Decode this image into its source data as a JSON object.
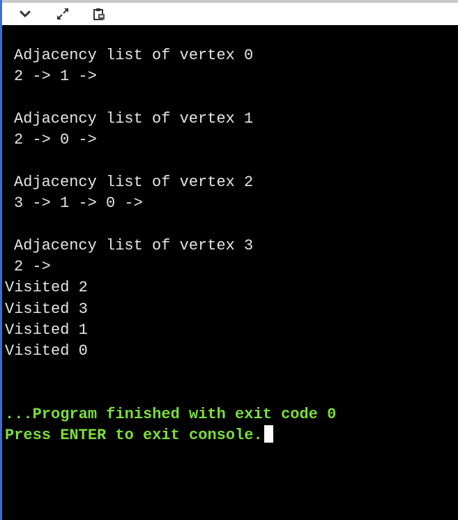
{
  "toolbar": {
    "collapse_icon": "chevron-down-icon",
    "expand_icon": "expand-arrows-icon",
    "save_icon": "clipboard-save-icon"
  },
  "console": {
    "output": [
      {
        "text": "Adjacency list of vertex 0",
        "indent": true
      },
      {
        "text": "2 -> 1 ->",
        "indent": true
      },
      {
        "text": "",
        "indent": true
      },
      {
        "text": "Adjacency list of vertex 1",
        "indent": true
      },
      {
        "text": "2 -> 0 ->",
        "indent": true
      },
      {
        "text": "",
        "indent": true
      },
      {
        "text": "Adjacency list of vertex 2",
        "indent": true
      },
      {
        "text": "3 -> 1 -> 0 ->",
        "indent": true
      },
      {
        "text": "",
        "indent": true
      },
      {
        "text": "Adjacency list of vertex 3",
        "indent": true
      },
      {
        "text": "2 ->",
        "indent": true
      },
      {
        "text": "Visited 2",
        "indent": false
      },
      {
        "text": "Visited 3",
        "indent": false
      },
      {
        "text": "Visited 1",
        "indent": false
      },
      {
        "text": "Visited 0",
        "indent": false
      },
      {
        "text": "",
        "indent": false
      },
      {
        "text": "",
        "indent": false
      }
    ],
    "finish_message": "...Program finished with exit code 0",
    "exit_prompt": "Press ENTER to exit console."
  },
  "colors": {
    "console_background": "#000000",
    "console_text": "#e6e6e6",
    "status_text": "#7cdd3c",
    "frame_border": "#3c6fd6"
  }
}
